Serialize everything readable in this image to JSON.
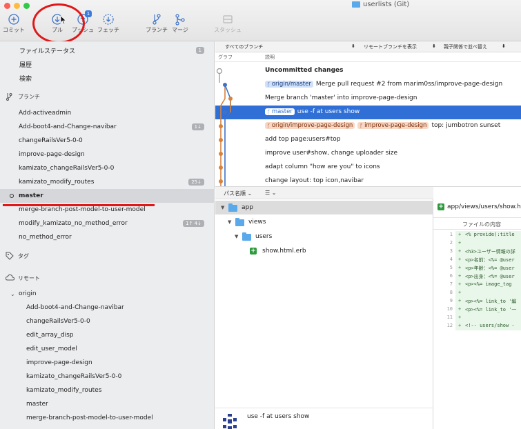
{
  "window": {
    "title": "userlists (Git)"
  },
  "toolbar": {
    "commit": "コミット",
    "pull": "プル",
    "push": "プッシュ",
    "push_badge": "1",
    "fetch": "フェッチ",
    "branch": "ブランチ",
    "merge": "マージ",
    "stash": "スタッシュ"
  },
  "sidebar": {
    "file_status": "ファイルステータス",
    "file_status_count": "1",
    "history": "履歴",
    "search": "検索",
    "branches_header": "ブランチ",
    "branches": [
      {
        "name": "Add-activeadmin",
        "count": ""
      },
      {
        "name": "Add-boot4-and-Change-navibar",
        "count": "1↓"
      },
      {
        "name": "changeRailsVer5-0-0",
        "count": ""
      },
      {
        "name": "improve-page-design",
        "count": ""
      },
      {
        "name": "kamizato_changeRailsVer5-0-0",
        "count": ""
      },
      {
        "name": "kamizato_modify_routes",
        "count": "25↓"
      },
      {
        "name": "master",
        "count": ""
      },
      {
        "name": "merge-branch-post-model-to-user-model",
        "count": ""
      },
      {
        "name": "modify_kamizato_no_method_error",
        "count": "1↑ 4↓"
      },
      {
        "name": "no_method_error",
        "count": ""
      }
    ],
    "tags_header": "タグ",
    "remotes_header": "リモート",
    "remote_name": "origin",
    "remote_branches": [
      "Add-boot4-and-Change-navibar",
      "changeRailsVer5-0-0",
      "edit_array_disp",
      "edit_user_model",
      "improve-page-design",
      "kamizato_changeRailsVer5-0-0",
      "kamizato_modify_routes",
      "master",
      "merge-branch-post-model-to-user-model"
    ]
  },
  "commit_list": {
    "filter_all_branches": "すべてのブランチ",
    "show_remote": "リモートブランチを表示",
    "sort": "親子関係で並べ替え",
    "col_graph": "グラフ",
    "col_desc": "説明",
    "commits": [
      {
        "refs": [],
        "message": "Uncommitted changes",
        "bold": true
      },
      {
        "refs": [
          {
            "name": "origin/master",
            "kind": "blue"
          }
        ],
        "message": "Merge pull request #2 from marim0ss/improve-page-design"
      },
      {
        "refs": [],
        "message": "Merge branch 'master' into improve-page-design"
      },
      {
        "refs": [
          {
            "name": "master",
            "kind": "sel"
          }
        ],
        "message": "use -f at users show",
        "selected": true
      },
      {
        "refs": [
          {
            "name": "origin/improve-page-design",
            "kind": "orange"
          },
          {
            "name": "improve-page-design",
            "kind": "orange"
          }
        ],
        "message": "top: jumbotron sunset"
      },
      {
        "refs": [],
        "message": "add top page:users#top"
      },
      {
        "refs": [],
        "message": "improve user#show, change uploader size"
      },
      {
        "refs": [],
        "message": "adapt column \"how are you\" to icons"
      },
      {
        "refs": [],
        "message": "change layout: top icon,navibar"
      }
    ]
  },
  "file_tree": {
    "path_sort": "パス名順 ⌄",
    "list_icon": "☰ ⌄",
    "items": [
      {
        "name": "app",
        "kind": "folder",
        "level": 0
      },
      {
        "name": "views",
        "kind": "folder",
        "level": 1
      },
      {
        "name": "users",
        "kind": "folder",
        "level": 2
      },
      {
        "name": "show.html.erb",
        "kind": "file-added",
        "level": 3
      }
    ],
    "footer_message": "use -f at users show"
  },
  "diff": {
    "file_path": "app/views/users/show.html.erb",
    "contents_label": "ファイルの内容",
    "lines": [
      {
        "n": "1",
        "text": "<% provide(:title"
      },
      {
        "n": "2",
        "text": ""
      },
      {
        "n": "3",
        "text": "<h3>ユーザー情報の詳"
      },
      {
        "n": "4",
        "text": "<p>名前：<%= @user"
      },
      {
        "n": "5",
        "text": "<p>年齢：<%= @user"
      },
      {
        "n": "6",
        "text": "<p>出身：<%= @user"
      },
      {
        "n": "7",
        "text": "<p><%= image_tag"
      },
      {
        "n": "8",
        "text": ""
      },
      {
        "n": "9",
        "text": "<p><%= link_to '編"
      },
      {
        "n": "10",
        "text": "<p><%= link_to '一"
      },
      {
        "n": "11",
        "text": ""
      },
      {
        "n": "12",
        "text": "<!-- users/show -"
      }
    ]
  },
  "colors": {
    "accent": "#2f6fd6",
    "annotation": "#e01818",
    "graph_blue": "#3e72c8",
    "graph_orange": "#d9823b"
  }
}
